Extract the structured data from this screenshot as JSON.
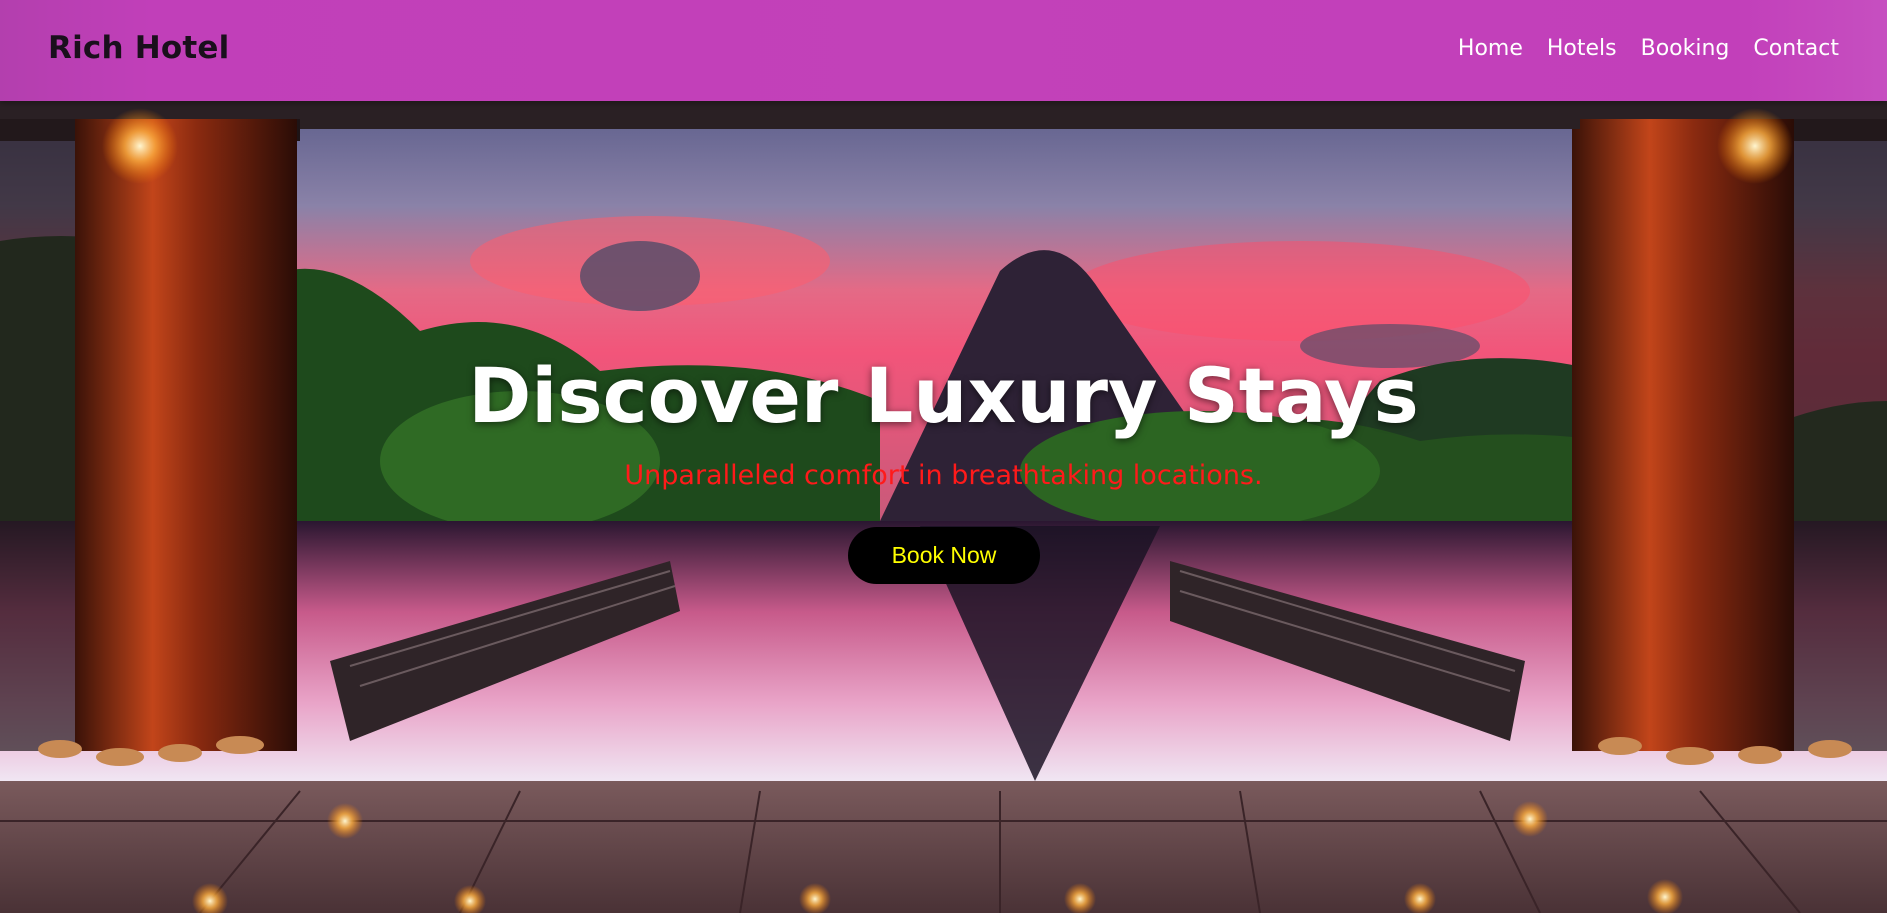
{
  "brand": {
    "name": "Rich Hotel"
  },
  "nav": {
    "items": [
      {
        "label": "Home"
      },
      {
        "label": "Hotels"
      },
      {
        "label": "Booking"
      },
      {
        "label": "Contact"
      }
    ]
  },
  "hero": {
    "title": "Discover Luxury Stays",
    "subtitle": "Unparalleled comfort in breathtaking locations.",
    "cta_label": "Book Now",
    "background_image": "sunset-pitons-infinity-pool"
  },
  "colors": {
    "navbar": "#c13fb9",
    "brand_text": "#1a0f1c",
    "nav_text": "#ffffff",
    "title_text": "#ffffff",
    "subtitle_text": "#ff1a1a",
    "button_bg": "#000000",
    "button_text": "#ffff00"
  }
}
